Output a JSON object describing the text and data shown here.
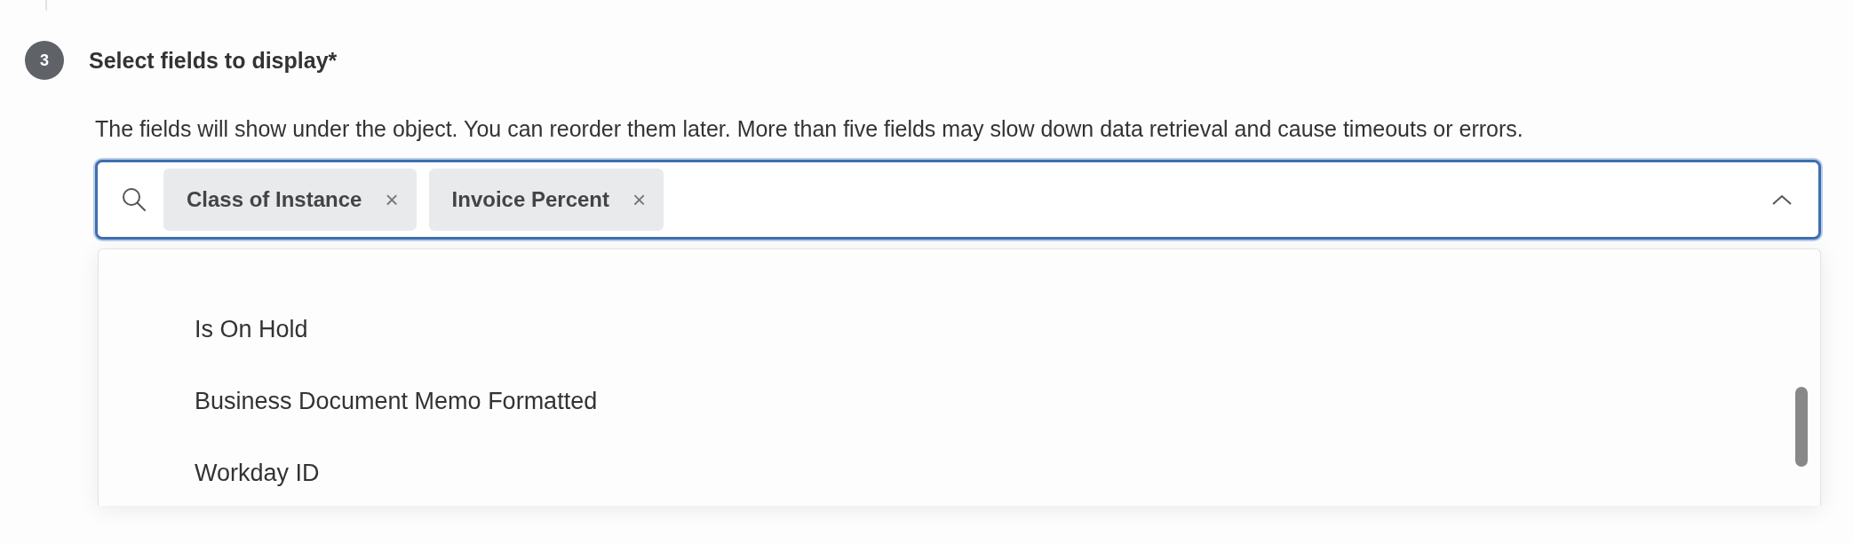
{
  "step": {
    "number": "3",
    "title": "Select fields to display*",
    "description": "The fields will show under the object. You can reorder them later. More than five fields may slow down data retrieval and cause timeouts or errors."
  },
  "field": {
    "expanded": true,
    "focused": true,
    "chips": [
      {
        "label": "Class of Instance",
        "remove": "×"
      },
      {
        "label": "Invoice Percent",
        "remove": "×"
      }
    ]
  },
  "options": [
    {
      "label": "Is On Hold"
    },
    {
      "label": "Business Document Memo Formatted"
    },
    {
      "label": "Workday ID"
    }
  ]
}
